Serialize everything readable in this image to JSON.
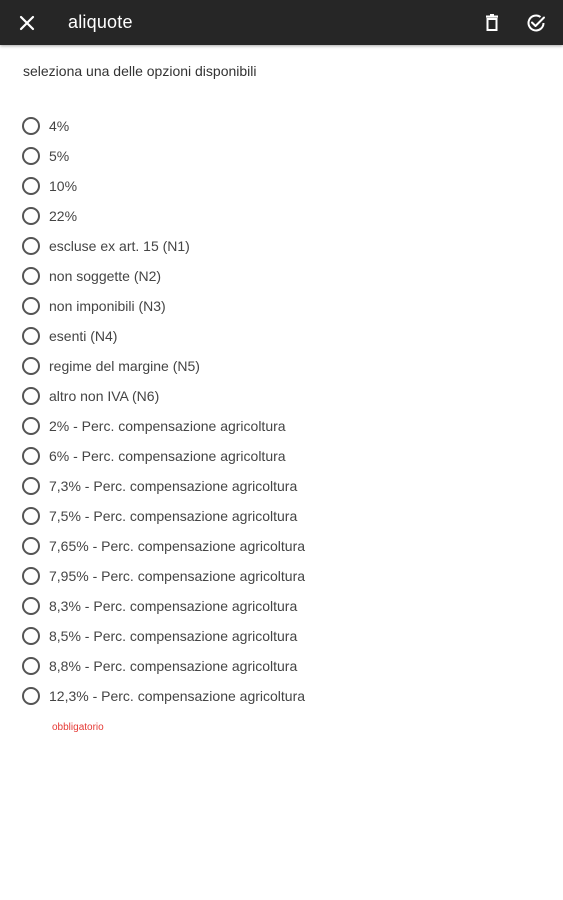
{
  "header": {
    "title": "aliquote",
    "close_icon": "close-icon",
    "delete_icon": "trash-icon",
    "confirm_icon": "check-circle-icon"
  },
  "prompt": "seleziona una delle opzioni disponibili",
  "options": [
    "4%",
    "5%",
    "10%",
    "22%",
    "escluse ex art. 15 (N1)",
    "non soggette (N2)",
    "non imponibili (N3)",
    "esenti (N4)",
    "regime del margine (N5)",
    "altro non IVA (N6)",
    "2% - Perc. compensazione agricoltura",
    "6% - Perc. compensazione agricoltura",
    "7,3% - Perc. compensazione agricoltura",
    "7,5% - Perc. compensazione agricoltura",
    "7,65% - Perc. compensazione agricoltura",
    "7,95% - Perc. compensazione agricoltura",
    "8,3% - Perc. compensazione agricoltura",
    "8,5% - Perc. compensazione agricoltura",
    "8,8% - Perc. compensazione agricoltura",
    "12,3% - Perc. compensazione agricoltura"
  ],
  "validation": "obbligatorio",
  "colors": {
    "appbar": "#262626",
    "error": "#e53935"
  }
}
